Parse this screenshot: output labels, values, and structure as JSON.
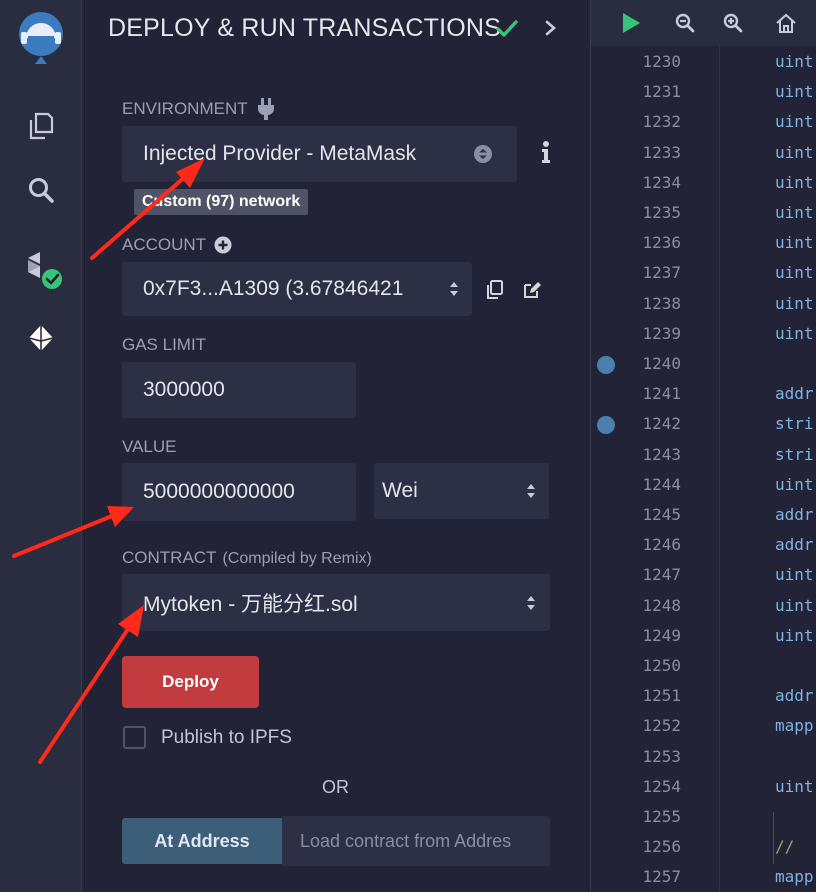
{
  "panel": {
    "title": "DEPLOY & RUN TRANSACTIONS",
    "environment": {
      "label": "ENVIRONMENT",
      "value": "Injected Provider - MetaMask",
      "network_tag": "Custom (97) network"
    },
    "account": {
      "label": "ACCOUNT",
      "value": "0x7F3...A1309 (3.67846421"
    },
    "gas_limit": {
      "label": "GAS LIMIT",
      "value": "3000000"
    },
    "value": {
      "label": "VALUE",
      "amount": "5000000000000",
      "unit": "Wei"
    },
    "contract": {
      "label": "CONTRACT",
      "sublabel": "(Compiled by Remix)",
      "value": "Mytoken - 万能分红.sol"
    },
    "deploy_label": "Deploy",
    "publish_label": "Publish to IPFS",
    "or_label": "OR",
    "at_address_label": "At Address",
    "load_placeholder": "Load contract from Addres"
  },
  "editor": {
    "lines": [
      {
        "n": "1230",
        "code": "uint"
      },
      {
        "n": "1231",
        "code": "uint"
      },
      {
        "n": "1232",
        "code": "uint"
      },
      {
        "n": "1233",
        "code": "uint"
      },
      {
        "n": "1234",
        "code": "uint"
      },
      {
        "n": "1235",
        "code": "uint"
      },
      {
        "n": "1236",
        "code": "uint"
      },
      {
        "n": "1237",
        "code": "uint"
      },
      {
        "n": "1238",
        "code": "uint"
      },
      {
        "n": "1239",
        "code": "uint"
      },
      {
        "n": "1240",
        "code": ""
      },
      {
        "n": "1241",
        "code": "addr"
      },
      {
        "n": "1242",
        "code": "stri"
      },
      {
        "n": "1243",
        "code": "stri"
      },
      {
        "n": "1244",
        "code": "uint"
      },
      {
        "n": "1245",
        "code": "addr"
      },
      {
        "n": "1246",
        "code": "addr"
      },
      {
        "n": "1247",
        "code": "uint"
      },
      {
        "n": "1248",
        "code": "uint"
      },
      {
        "n": "1249",
        "code": "uint"
      },
      {
        "n": "1250",
        "code": ""
      },
      {
        "n": "1251",
        "code": "addr"
      },
      {
        "n": "1252",
        "code": "mapp"
      },
      {
        "n": "1253",
        "code": ""
      },
      {
        "n": "1254",
        "code": "uint"
      },
      {
        "n": "1255",
        "code": ""
      },
      {
        "n": "1256",
        "code": "  //"
      },
      {
        "n": "1257",
        "code": "mapp"
      }
    ]
  },
  "colors": {
    "background": "#222336",
    "deploy_button": "#c23b3f",
    "check_green": "#37c47a",
    "arrow_red": "#ff2a1a"
  }
}
